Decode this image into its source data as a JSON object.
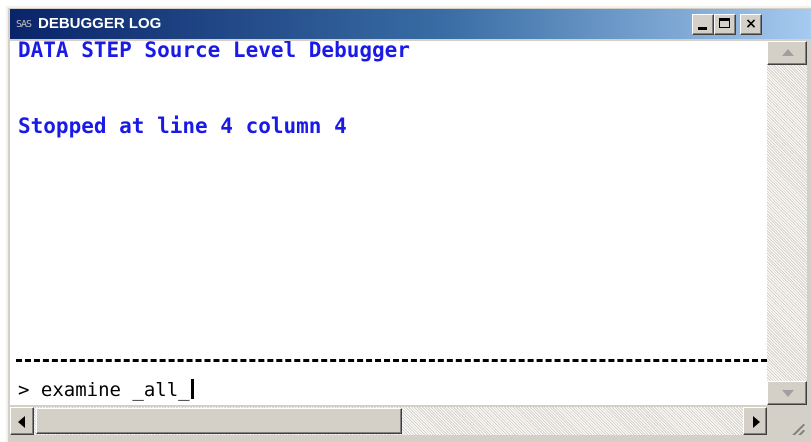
{
  "window": {
    "title": "DEBUGGER LOG",
    "icon": "sas-app-icon",
    "icon_text": "SAS",
    "controls": {
      "minimize_icon": "minimize-icon",
      "maximize_icon": "maximize-icon",
      "close_icon": "close-icon",
      "close_glyph": "×"
    }
  },
  "log": {
    "lines": [
      "DATA STEP Source Level Debugger",
      "Stopped at line 4 column 4"
    ],
    "text_color": "#1a1ae6"
  },
  "command": {
    "prompt": "> ",
    "value": "examine _all_"
  },
  "colors": {
    "titlebar_start": "#0a246a",
    "titlebar_end": "#a6caf0",
    "log_text": "#1a1ae6",
    "chrome": "#d4d0c8"
  }
}
